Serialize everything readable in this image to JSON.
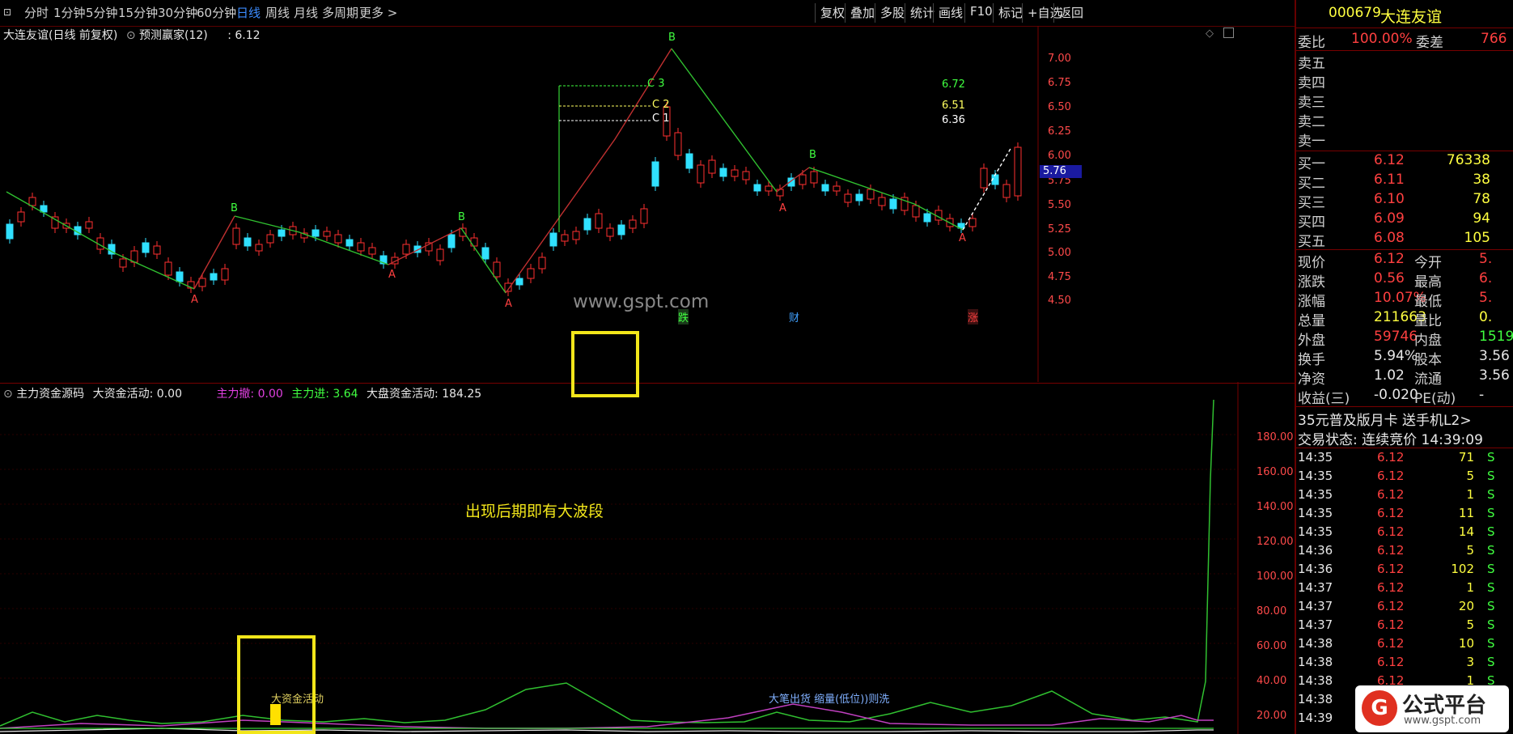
{
  "toolbar": {
    "periods": [
      "分时",
      "1分钟",
      "5分钟",
      "15分钟",
      "30分钟",
      "60分钟",
      "日线",
      "周线",
      "月线",
      "多周期",
      "更多 >"
    ],
    "right_buttons": [
      "复权",
      "叠加",
      "多股",
      "统计",
      "画线",
      "F10",
      "标记",
      "+自选",
      "返回"
    ]
  },
  "main": {
    "title": "大连友谊(日线 前复权)",
    "indicator_name": "预测赢家(12)",
    "indicator_value": ": 6.12",
    "price_label": "5.76",
    "y_ticks": [
      "7.00",
      "6.75",
      "6.50",
      "6.25",
      "6.00",
      "5.75",
      "5.50",
      "5.25",
      "5.00",
      "4.75",
      "4.50"
    ],
    "c_labels": [
      "C 3",
      "C 2",
      "C 1"
    ],
    "target_values": [
      "6.72",
      "6.51",
      "6.36"
    ],
    "watermark": "www.gspt.com",
    "event_tags": [
      "跌",
      "财",
      "涨"
    ],
    "wave_labels": [
      "A",
      "B",
      "A",
      "B",
      "A",
      "B",
      "A",
      "B",
      "A"
    ]
  },
  "indicator": {
    "name": "主力资金源码",
    "items": [
      {
        "label": "大资金活动: 0.00",
        "color": "#e8e8e8"
      },
      {
        "label": "主力撤: 0.00",
        "color": "#e040e0"
      },
      {
        "label": "主力进: 3.64",
        "color": "#40ff40"
      },
      {
        "label": "大盘资金活动: 184.25",
        "color": "#e8e8e8"
      }
    ],
    "y_ticks": [
      "180.00",
      "160.00",
      "140.00",
      "120.00",
      "100.00",
      "80.00",
      "60.00",
      "40.00",
      "20.00"
    ],
    "annotation": "出现后期即有大波段",
    "text_big_fund": "大资金活动",
    "text_sell": "大笔出货 缩量(低位))则洗"
  },
  "quote": {
    "code": "000679",
    "name": "大连友谊",
    "weibi_label": "委比",
    "weibi_value": "100.00%",
    "weicha_label": "委差",
    "weicha_value": "766",
    "sells": [
      "卖五",
      "卖四",
      "卖三",
      "卖二",
      "卖一"
    ],
    "buys": [
      {
        "label": "买一",
        "price": "6.12",
        "vol": "76338"
      },
      {
        "label": "买二",
        "price": "6.11",
        "vol": "38"
      },
      {
        "label": "买三",
        "price": "6.10",
        "vol": "78"
      },
      {
        "label": "买四",
        "price": "6.09",
        "vol": "94"
      },
      {
        "label": "买五",
        "price": "6.08",
        "vol": "105"
      }
    ],
    "stats": [
      {
        "l1": "现价",
        "v1": "6.12",
        "c1": "#ff4040",
        "l2": "今开",
        "v2": "5.",
        "c2": "#ff4040"
      },
      {
        "l1": "涨跌",
        "v1": "0.56",
        "c1": "#ff4040",
        "l2": "最高",
        "v2": "6.",
        "c2": "#ff4040"
      },
      {
        "l1": "涨幅",
        "v1": "10.07%",
        "c1": "#ff4040",
        "l2": "最低",
        "v2": "5.",
        "c2": "#ff4040"
      },
      {
        "l1": "总量",
        "v1": "211663",
        "c1": "#ffff40",
        "l2": "量比",
        "v2": "0.",
        "c2": "#ffff40"
      },
      {
        "l1": "外盘",
        "v1": "59746",
        "c1": "#ff4040",
        "l2": "内盘",
        "v2": "1519",
        "c2": "#40ff40"
      },
      {
        "l1": "换手",
        "v1": "5.94%",
        "c1": "#e8e8e8",
        "l2": "股本",
        "v2": "3.56",
        "c2": "#e8e8e8"
      },
      {
        "l1": "净资",
        "v1": "1.02",
        "c1": "#e8e8e8",
        "l2": "流通",
        "v2": "3.56",
        "c2": "#e8e8e8"
      },
      {
        "l1": "收益(三)",
        "v1": "-0.020",
        "c1": "#e8e8e8",
        "l2": "PE(动)",
        "v2": "-",
        "c2": "#e8e8e8"
      }
    ],
    "promo": "35元普及版月卡 送手机L2>",
    "status": "交易状态: 连续竞价 14:39:09",
    "ticks": [
      {
        "t": "14:35",
        "p": "6.12",
        "v": "71",
        "s": "S"
      },
      {
        "t": "14:35",
        "p": "6.12",
        "v": "5",
        "s": "S"
      },
      {
        "t": "14:35",
        "p": "6.12",
        "v": "1",
        "s": "S"
      },
      {
        "t": "14:35",
        "p": "6.12",
        "v": "11",
        "s": "S"
      },
      {
        "t": "14:35",
        "p": "6.12",
        "v": "14",
        "s": "S"
      },
      {
        "t": "14:36",
        "p": "6.12",
        "v": "5",
        "s": "S"
      },
      {
        "t": "14:36",
        "p": "6.12",
        "v": "102",
        "s": "S"
      },
      {
        "t": "14:37",
        "p": "6.12",
        "v": "1",
        "s": "S"
      },
      {
        "t": "14:37",
        "p": "6.12",
        "v": "20",
        "s": "S"
      },
      {
        "t": "14:37",
        "p": "6.12",
        "v": "5",
        "s": "S"
      },
      {
        "t": "14:38",
        "p": "6.12",
        "v": "10",
        "s": "S"
      },
      {
        "t": "14:38",
        "p": "6.12",
        "v": "3",
        "s": "S"
      },
      {
        "t": "14:38",
        "p": "6.12",
        "v": "1",
        "s": "S"
      },
      {
        "t": "14:38",
        "p": "",
        "v": "",
        "s": ""
      },
      {
        "t": "14:39",
        "p": "",
        "v": "",
        "s": ""
      }
    ],
    "logo_text": "公式平台",
    "logo_url": "www.gspt.com"
  }
}
